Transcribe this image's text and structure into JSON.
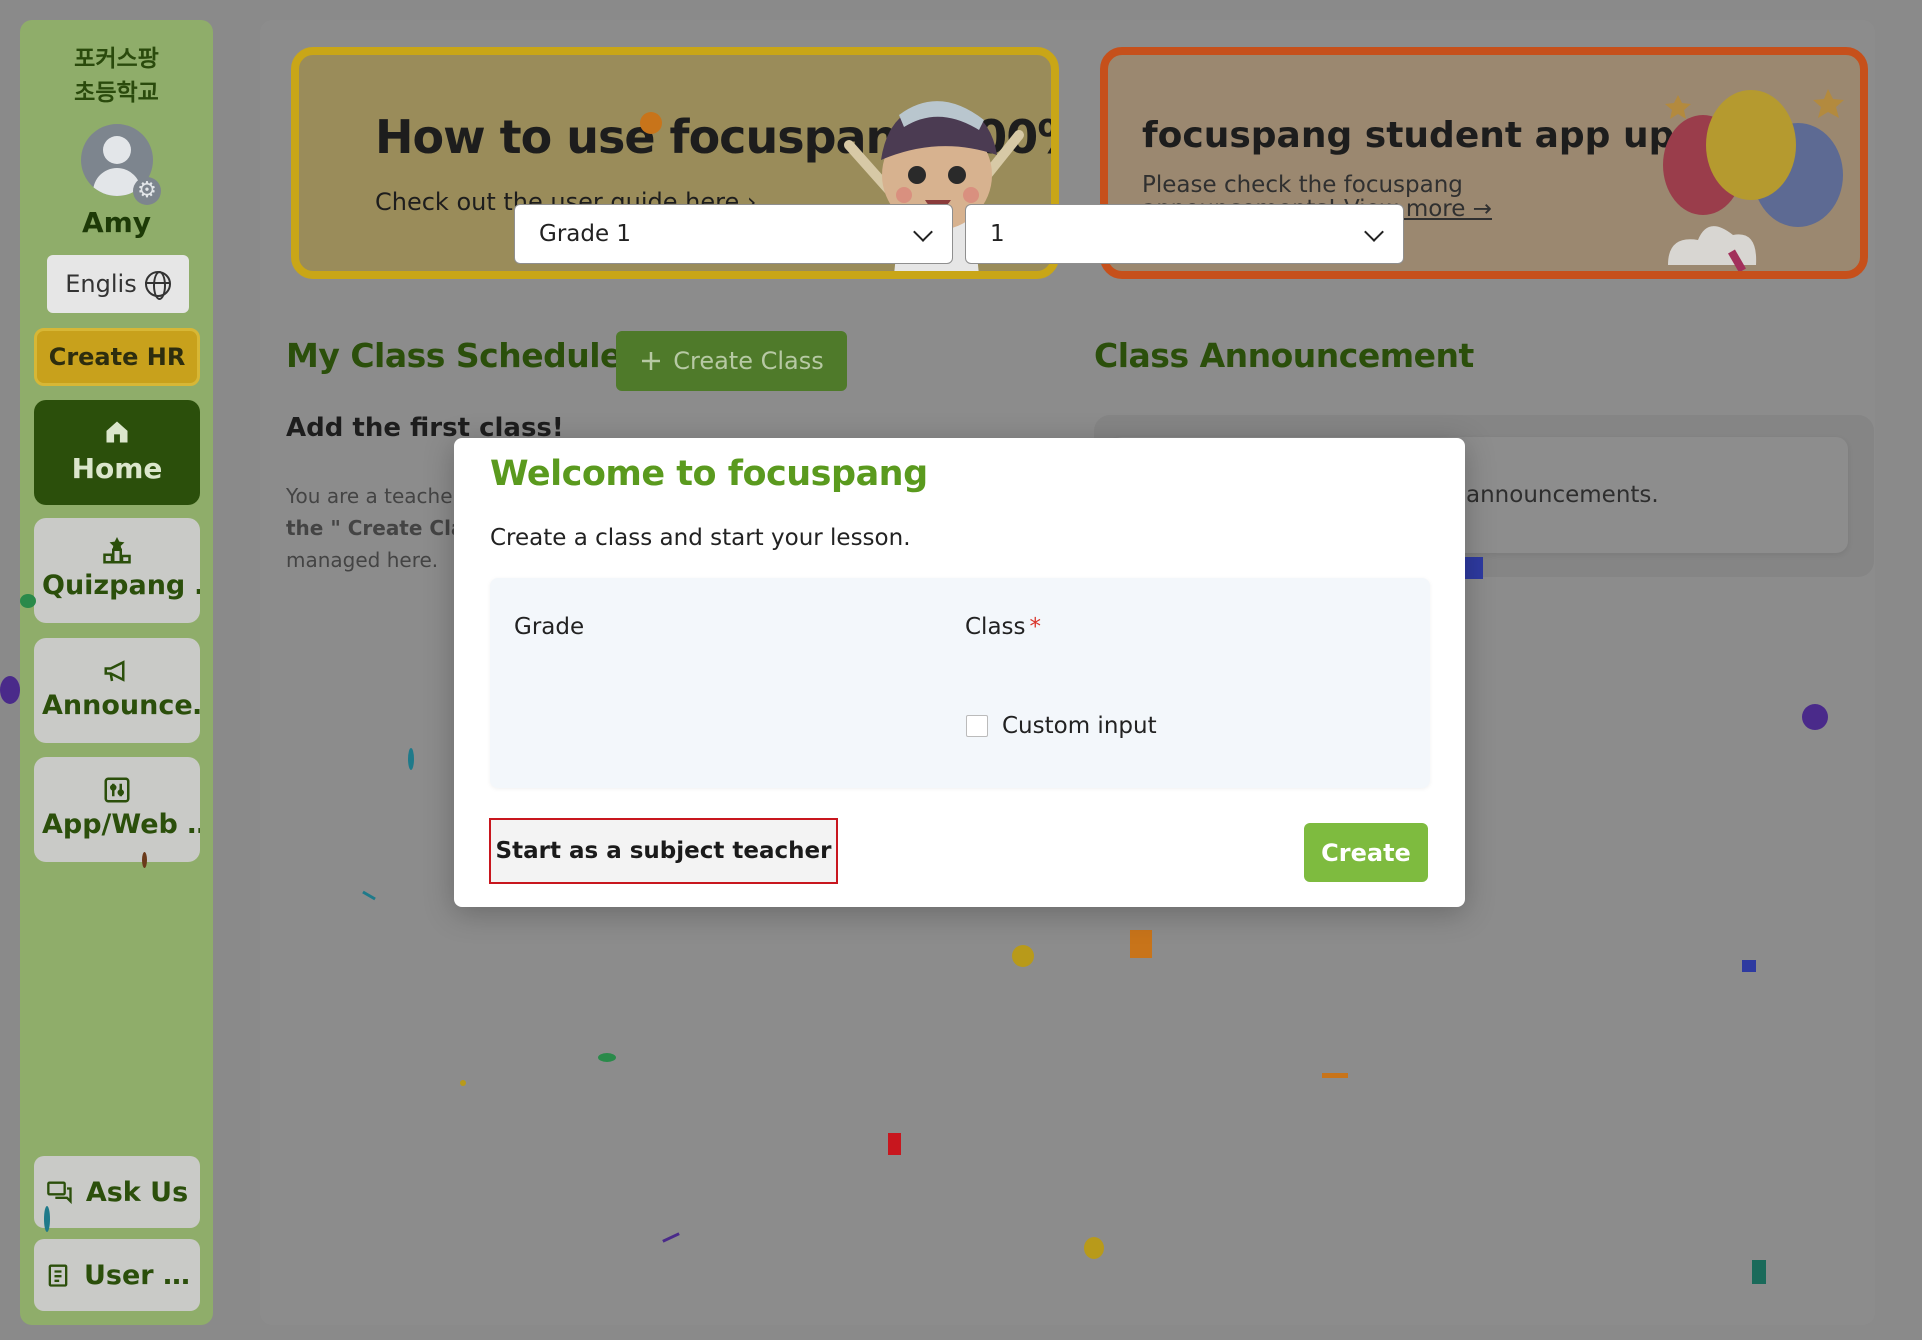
{
  "sidebar": {
    "school_name": "포커스팡 초등학교",
    "username": "Amy",
    "language_label": "Englis",
    "create_hr_label": "Create HR",
    "nav": [
      {
        "label": "Home",
        "icon": "home-icon"
      },
      {
        "label": "Quizpang …",
        "icon": "podium-icon"
      },
      {
        "label": "Announce…",
        "icon": "megaphone-icon"
      },
      {
        "label": "App/Web …",
        "icon": "sliders-icon"
      }
    ],
    "ask_us_label": "Ask Us",
    "user_label": "User …"
  },
  "banners": {
    "left": {
      "title": "How to use focuspang 100%",
      "subtitle": "Check out the user guide here ›"
    },
    "right": {
      "title": "focuspang student app update",
      "subtitle": "Please check the focuspang announcements!",
      "link": "View more →"
    }
  },
  "schedule": {
    "title": "My Class Schedule",
    "create_class_label": "Create Class",
    "empty_title": "Add the first class!",
    "hint_lines": [
      "You are a teache",
      "the \" Create Clas",
      "managed here."
    ]
  },
  "announcement": {
    "title": "Class Announcement",
    "empty_text": "announcements."
  },
  "modal": {
    "title": "Welcome to focuspang",
    "description": "Create a class and start your lesson.",
    "grade_label": "Grade",
    "class_label": "Class",
    "required_mark": "*",
    "grade_value": "Grade 1",
    "class_value": "1",
    "custom_input_label": "Custom input",
    "subject_teacher_label": "Start as a subject teacher",
    "create_label": "Create"
  },
  "colors": {
    "brand_green": "#5a9a1e",
    "create_green": "#7ebb3f",
    "highlight_red": "#c8161e"
  }
}
